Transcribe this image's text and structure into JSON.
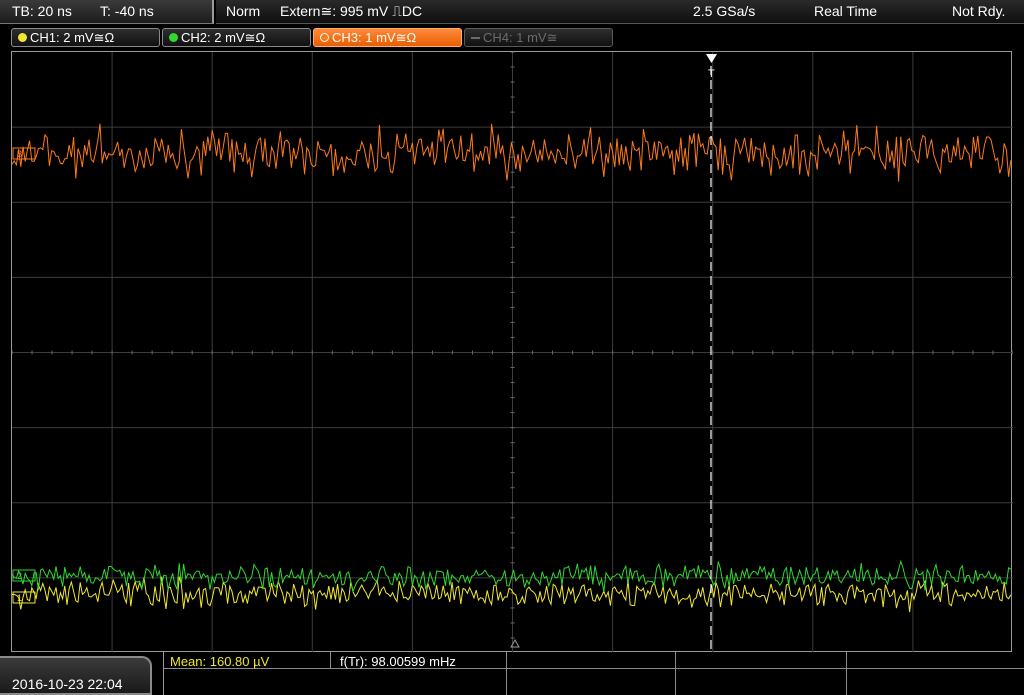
{
  "top": {
    "timebase": "TB: 20 ns",
    "trigger_offset": "T: -40 ns",
    "mode": "Norm",
    "trigger_source": "Extern≅: 995 mV ⎍DC",
    "sample_rate": "2.5 GSa/s",
    "acq_mode": "Real Time",
    "status": "Not Rdy."
  },
  "channels": [
    {
      "label": "CH1: 2 mV≅Ω",
      "color": "#f0e832",
      "state": "on"
    },
    {
      "label": "CH2: 2 mV≅Ω",
      "color": "#30d830",
      "state": "on"
    },
    {
      "label": "CH3: 1 mV≅Ω",
      "color": "#ff7a1a",
      "state": "active"
    },
    {
      "label": "CH4: 1 mV≅",
      "color": "#6b6b6b",
      "state": "off"
    }
  ],
  "markers": {
    "ch3": "3",
    "ch2": "2",
    "ch1": "1",
    "trigger": "T"
  },
  "bottom": {
    "datetime": "2016-10-23 22:04",
    "mean": "Mean: 160.80 µV",
    "freq": "f(Tr): 98.00599 mHz"
  },
  "colors": {
    "ch1": "#f0e832",
    "ch2": "#30d830",
    "ch3": "#ff7a1a",
    "grid": "#3d3d3d"
  }
}
